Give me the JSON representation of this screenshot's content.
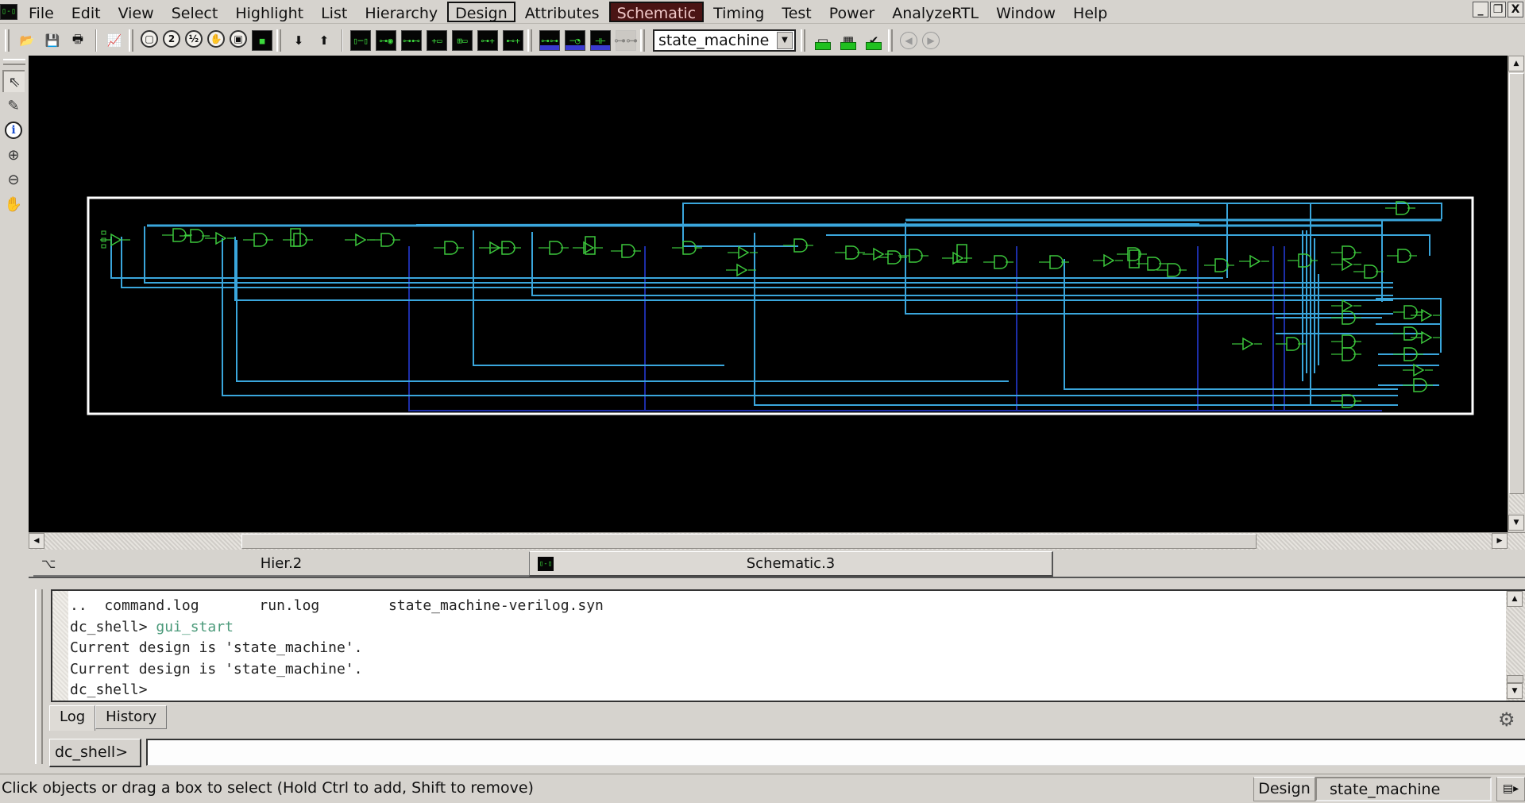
{
  "menubar": {
    "items": [
      {
        "label": "File",
        "state": "normal"
      },
      {
        "label": "Edit",
        "state": "normal"
      },
      {
        "label": "View",
        "state": "normal"
      },
      {
        "label": "Select",
        "state": "normal"
      },
      {
        "label": "Highlight",
        "state": "normal"
      },
      {
        "label": "List",
        "state": "normal"
      },
      {
        "label": "Hierarchy",
        "state": "normal"
      },
      {
        "label": "Design",
        "state": "boxed"
      },
      {
        "label": "Attributes",
        "state": "normal"
      },
      {
        "label": "Schematic",
        "state": "active"
      },
      {
        "label": "Timing",
        "state": "normal"
      },
      {
        "label": "Test",
        "state": "normal"
      },
      {
        "label": "Power",
        "state": "normal"
      },
      {
        "label": "AnalyzeRTL",
        "state": "normal"
      },
      {
        "label": "Window",
        "state": "normal"
      },
      {
        "label": "Help",
        "state": "normal"
      }
    ],
    "window_controls": {
      "minimize": "_",
      "restore": "❐",
      "close": "X"
    }
  },
  "toolbar": {
    "file_tools": [
      "open-folder-icon",
      "save-disk-icon",
      "print-icon",
      "report-icon"
    ],
    "zoom_tools": [
      {
        "icon": "zoom-fit-icon",
        "glyph": "▢"
      },
      {
        "icon": "zoom-2x-icon",
        "glyph": "2"
      },
      {
        "icon": "zoom-half-icon",
        "glyph": "½"
      },
      {
        "icon": "pan-fit-icon",
        "glyph": "✋"
      },
      {
        "icon": "zoom-selection-icon",
        "glyph": "▣"
      },
      {
        "icon": "fit-selected-icon",
        "glyph": "■"
      }
    ],
    "hierarchy_tools": [
      {
        "icon": "push-down-icon",
        "glyph": "⬇"
      },
      {
        "icon": "pop-up-icon",
        "glyph": "⬆"
      }
    ],
    "schematic_tools": [
      {
        "icon": "new-schematic-icon",
        "glyph": "▯─▯"
      },
      {
        "icon": "schematic-path-icon",
        "glyph": "⊶◉"
      },
      {
        "icon": "fanout-icon",
        "glyph": "⊶⊷"
      },
      {
        "icon": "add-fanin-icon",
        "glyph": "+▭"
      },
      {
        "icon": "add-fanout-icon",
        "glyph": "⊞▭"
      },
      {
        "icon": "expand-net-icon",
        "glyph": "⊶+"
      },
      {
        "icon": "collapse-net-icon",
        "glyph": "⊷+"
      }
    ],
    "timing_tools": [
      {
        "icon": "timing-path-icon",
        "glyph": "⊶⊶"
      },
      {
        "icon": "timing-histogram-icon",
        "glyph": "─◔"
      },
      {
        "icon": "slack-histogram-icon",
        "glyph": "⊣⊢"
      },
      {
        "icon": "disabled-tool-icon",
        "glyph": "⊶⊶"
      }
    ],
    "design_select": {
      "value": "state_machine"
    },
    "layout_tools": [
      {
        "icon": "layout-window-icon",
        "glyph": "▭"
      },
      {
        "icon": "module-view-icon",
        "glyph": "▦"
      },
      {
        "icon": "check-design-icon",
        "glyph": "✔"
      }
    ],
    "nav_tools": [
      {
        "icon": "back-icon",
        "glyph": "◀"
      },
      {
        "icon": "forward-icon",
        "glyph": "▶"
      }
    ]
  },
  "side_toolbar": [
    {
      "icon": "select-arrow-icon",
      "glyph": "⇖",
      "selected": true
    },
    {
      "icon": "pencil-icon",
      "glyph": "✎",
      "selected": false
    },
    {
      "icon": "info-icon",
      "glyph": "i",
      "selected": false
    },
    {
      "icon": "zoom-in-icon",
      "glyph": "⊕",
      "selected": false
    },
    {
      "icon": "zoom-out-icon",
      "glyph": "⊖",
      "selected": false
    },
    {
      "icon": "pan-hand-icon",
      "glyph": "✋",
      "selected": false
    }
  ],
  "schematic": {
    "colors": {
      "background": "#000000",
      "border": "#ffffff",
      "cells": "#3cc83c",
      "nets": "#3aa6dc",
      "bus_nets": "#1c2ea8"
    }
  },
  "doc_tabs": [
    {
      "label": "Hier.2",
      "icon": "hierarchy-icon",
      "active": false
    },
    {
      "label": "Schematic.3",
      "icon": "schematic-icon",
      "active": true
    }
  ],
  "console": {
    "lines": [
      {
        "prompt": "",
        "text": "..  command.log       run.log        state_machine-verilog.syn",
        "cmd": ""
      },
      {
        "prompt": "dc_shell> ",
        "text": "",
        "cmd": "gui_start"
      },
      {
        "prompt": "",
        "text": "Current design is 'state_machine'.",
        "cmd": ""
      },
      {
        "prompt": "",
        "text": "Current design is 'state_machine'.",
        "cmd": ""
      },
      {
        "prompt": "dc_shell>",
        "text": "",
        "cmd": ""
      }
    ],
    "tabs": [
      {
        "label": "Log",
        "active": true
      },
      {
        "label": "History",
        "active": false
      }
    ],
    "prompt_label": "dc_shell>",
    "input_value": ""
  },
  "statusbar": {
    "message": "Click objects or drag a box to select (Hold Ctrl to add, Shift to remove)",
    "design_label": "Design",
    "design_value": "state_machine"
  }
}
